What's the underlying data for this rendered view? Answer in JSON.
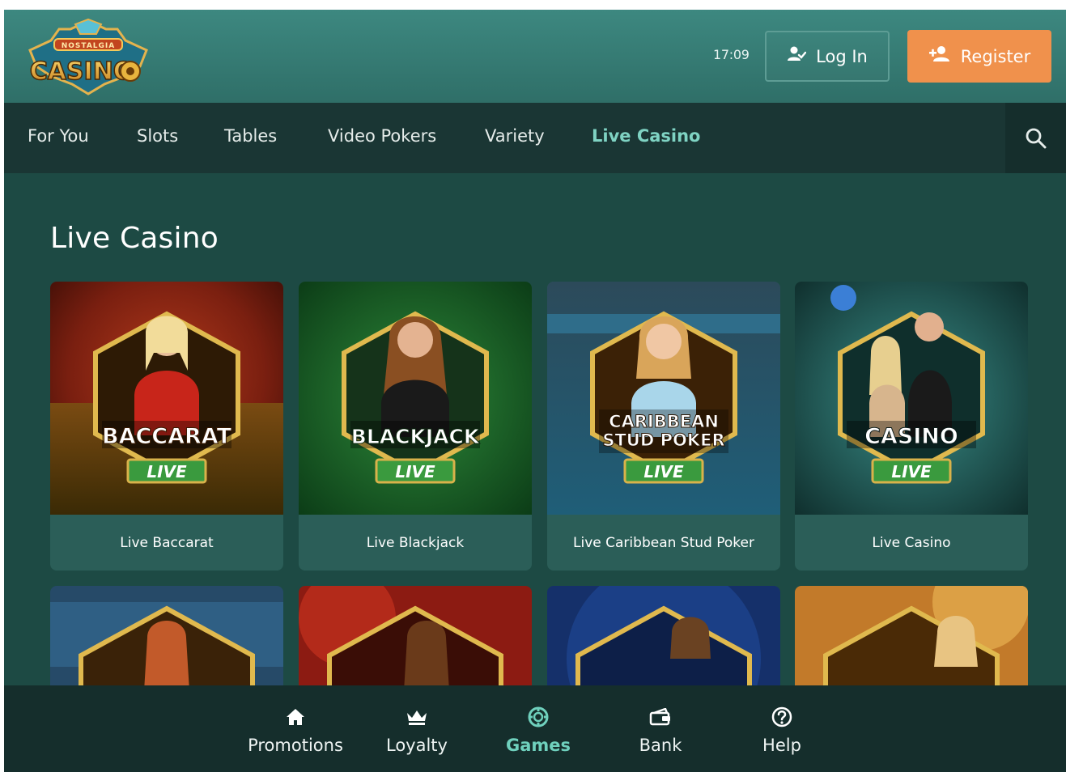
{
  "header": {
    "logo_text_top": "NOSTALGIA",
    "logo_text_main": "CASINO",
    "clock": "17:09",
    "login_label": "Log In",
    "register_label": "Register",
    "login_icon": "user-check-icon",
    "register_icon": "user-plus-icon"
  },
  "category_nav": {
    "tabs": [
      {
        "label": "For You",
        "active": false
      },
      {
        "label": "Slots",
        "active": false
      },
      {
        "label": "Tables",
        "active": false
      },
      {
        "label": "Video Pokers",
        "active": false
      },
      {
        "label": "Variety",
        "active": false
      },
      {
        "label": "Live Casino",
        "active": true
      }
    ],
    "search_icon": "search-icon"
  },
  "main": {
    "section_title": "Live Casino",
    "games": [
      {
        "title": "Live Baccarat",
        "badge_title": "BACCARAT",
        "badge_live": "LIVE"
      },
      {
        "title": "Live Blackjack",
        "badge_title": "BLACKJACK",
        "badge_live": "LIVE"
      },
      {
        "title": "Live Caribbean Stud Poker",
        "badge_title_line1": "CARIBBEAN",
        "badge_title_line2": "STUD POKER",
        "badge_live": "LIVE"
      },
      {
        "title": "Live Casino",
        "badge_title": "CASINO",
        "badge_live": "LIVE"
      }
    ]
  },
  "bottom_nav": {
    "items": [
      {
        "label": "Promotions",
        "icon": "home-icon",
        "active": false
      },
      {
        "label": "Loyalty",
        "icon": "crown-icon",
        "active": false
      },
      {
        "label": "Games",
        "icon": "chip-icon",
        "active": true
      },
      {
        "label": "Bank",
        "icon": "wallet-icon",
        "active": false
      },
      {
        "label": "Help",
        "icon": "help-icon",
        "active": false
      }
    ]
  },
  "colors": {
    "accent_orange": "#f0914c",
    "active_teal": "#7fd3c3",
    "live_green": "#3a9a3e",
    "badge_gold": "#d9b24a"
  }
}
